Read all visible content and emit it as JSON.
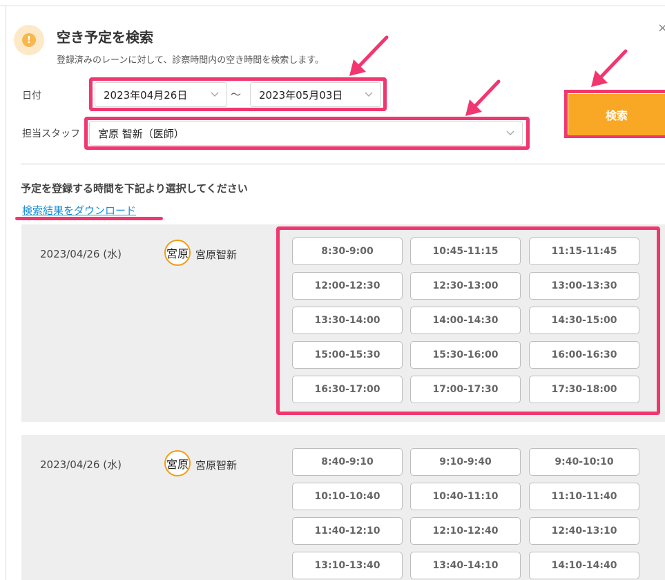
{
  "dialog": {
    "title": "空き予定を検索",
    "subtitle": "登録済みのレーンに対して、診察時間内の空き時間を検索します。",
    "close_label": "×",
    "warn_symbol": "!"
  },
  "form": {
    "date_label": "日付",
    "date_from": "2023年04月26日",
    "date_separator": "〜",
    "date_to": "2023年05月03日",
    "staff_label": "担当スタッフ",
    "staff_value": "宮原 智新（医師）",
    "search_button": "検索"
  },
  "results": {
    "instruction": "予定を登録する時間を下記より選択してください",
    "download_link": "検索結果をダウンロード",
    "groups": [
      {
        "date": "2023/04/26 (水)",
        "avatar": "宮原",
        "staff": "宮原智新",
        "slots": [
          "8:30-9:00",
          "10:45-11:15",
          "11:15-11:45",
          "12:00-12:30",
          "12:30-13:00",
          "13:00-13:30",
          "13:30-14:00",
          "14:00-14:30",
          "14:30-15:00",
          "15:00-15:30",
          "15:30-16:00",
          "16:00-16:30",
          "16:30-17:00",
          "17:00-17:30",
          "17:30-18:00"
        ]
      },
      {
        "date": "2023/04/26 (水)",
        "avatar": "宮原",
        "staff": "宮原智新",
        "slots": [
          "8:40-9:10",
          "9:10-9:40",
          "9:40-10:10",
          "10:10-10:40",
          "10:40-11:10",
          "11:10-11:40",
          "11:40-12:10",
          "12:10-12:40",
          "12:40-13:10",
          "13:10-13:40",
          "13:40-14:10",
          "14:10-14:40"
        ]
      }
    ]
  },
  "colors": {
    "accent": "#f9a825",
    "highlight": "#f0376f",
    "link": "#1890d6",
    "group_bg": "#eeeeee"
  }
}
